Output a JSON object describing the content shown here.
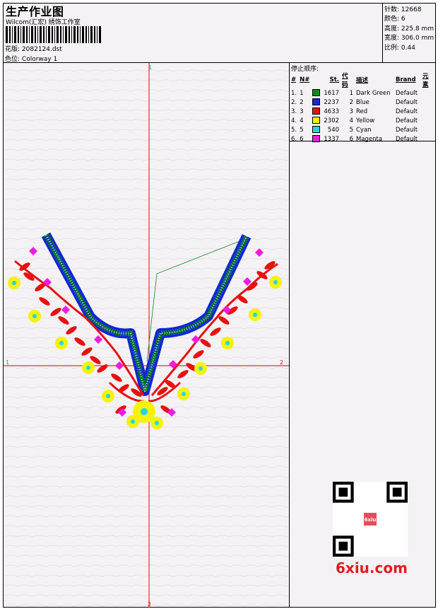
{
  "header": {
    "title": "生产作业图",
    "studio": "Wilcom(汇宏) 绣饰工作室",
    "design_file_label": "花版:",
    "design_file": "2082124.dst",
    "colorway_label": "色位:",
    "colorway": "Colorway 1"
  },
  "stats": {
    "stitches_label": "针数:",
    "stitches": "12668",
    "colors_label": "颜色:",
    "colors": "6",
    "height_label": "高度:",
    "height": "225.8 mm",
    "width_label": "宽度:",
    "width": "306.0 mm",
    "ratio_label": "比例:",
    "ratio": "0.44"
  },
  "stop_sequence": {
    "title": "停止顺序:",
    "headers": [
      "#",
      "N#",
      "St.",
      "代码",
      "描述",
      "Brand",
      "元素"
    ],
    "rows": [
      {
        "idx": "1.",
        "n": "1",
        "color": "#0f8a1e",
        "st": "1617",
        "code": "1",
        "desc": "Dark Green",
        "brand": "Default"
      },
      {
        "idx": "2.",
        "n": "2",
        "color": "#1226d6",
        "st": "2237",
        "code": "2",
        "desc": "Blue",
        "brand": "Default"
      },
      {
        "idx": "3.",
        "n": "3",
        "color": "#e81010",
        "st": "4633",
        "code": "3",
        "desc": "Red",
        "brand": "Default"
      },
      {
        "idx": "4.",
        "n": "4",
        "color": "#f5f20c",
        "st": "2302",
        "code": "4",
        "desc": "Yellow",
        "brand": "Default"
      },
      {
        "idx": "5.",
        "n": "5",
        "color": "#27d4e4",
        "st": "540",
        "code": "5",
        "desc": "Cyan",
        "brand": "Default"
      },
      {
        "idx": "6.",
        "n": "6",
        "color": "#ee1be0",
        "st": "1337",
        "code": "6",
        "desc": "Magenta",
        "brand": "Default"
      }
    ]
  },
  "axes": {
    "top": "1",
    "left": "1",
    "right": "2",
    "bottom": "2"
  },
  "watermark": {
    "qr_stamp": "6xiu",
    "text": "6xiu.com"
  }
}
